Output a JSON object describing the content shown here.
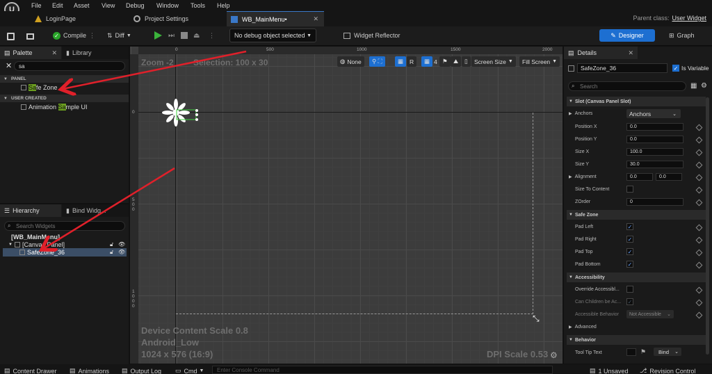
{
  "menu": [
    "File",
    "Edit",
    "Asset",
    "View",
    "Debug",
    "Window",
    "Tools",
    "Help"
  ],
  "tabs": [
    {
      "label": "LoginPage"
    },
    {
      "label": "Project Settings"
    },
    {
      "label": "WB_MainMenu•"
    }
  ],
  "parent_class": {
    "label": "Parent class:",
    "value": "User Widget"
  },
  "toolbar": {
    "compile": "Compile",
    "diff": "Diff",
    "debug_object": "No debug object selected",
    "widget_reflector": "Widget Reflector",
    "designer": "Designer",
    "graph": "Graph"
  },
  "palette": {
    "tab_palette": "Palette",
    "tab_library": "Library",
    "search_value": "sa",
    "cat_panel": "PANEL",
    "item_safezone": {
      "pre": "",
      "match": "Sa",
      "post": "fe Zone"
    },
    "cat_user": "USER CREATED",
    "item_anim": {
      "pre": "Animation ",
      "match": "Sa",
      "post": "mple UI"
    }
  },
  "hierarchy": {
    "tab_hierarchy": "Hierarchy",
    "tab_bind": "Bind Widg...",
    "search_placeholder": "Search Widgets",
    "root": "[WB_MainMenu]",
    "canvas": "[Canvas Panel]",
    "safezone": "SafeZone_36"
  },
  "canvas": {
    "zoom": "Zoom -2",
    "selection": "Selection: 100 x 30",
    "none_label": "None",
    "r_label": "R",
    "grid_value": "4",
    "screen_size": "Screen Size",
    "fill_screen": "Fill Screen",
    "ruler_top": [
      "0",
      "500",
      "1000",
      "1500",
      "2000"
    ],
    "ruler_left": [
      "0",
      "5\n0\n0",
      "1\n0\n0\n0"
    ],
    "device_scale": "Device Content Scale 0.8",
    "device": "Android_Low",
    "resolution": "1024 x 576 (16:9)",
    "dpi": "DPI Scale 0.53"
  },
  "details": {
    "tab": "Details",
    "name": "SafeZone_36",
    "is_variable": "Is Variable",
    "search_placeholder": "Search",
    "slot_section": "Slot (Canvas Panel Slot)",
    "anchors_label": "Anchors",
    "anchors_value": "Anchors",
    "position_x": "Position X",
    "position_x_val": "0.0",
    "position_y": "Position Y",
    "position_y_val": "0.0",
    "size_x": "Size X",
    "size_x_val": "100.0",
    "size_y": "Size Y",
    "size_y_val": "30.0",
    "alignment": "Alignment",
    "align_x": "0.0",
    "align_y": "0.0",
    "size_to_content": "Size To Content",
    "zorder": "ZOrder",
    "zorder_val": "0",
    "safe_zone_section": "Safe Zone",
    "pad_left": "Pad Left",
    "pad_right": "Pad Right",
    "pad_top": "Pad Top",
    "pad_bottom": "Pad Bottom",
    "accessibility_section": "Accessibility",
    "override_access": "Override Accessibl...",
    "children_access": "Can Children be Ac...",
    "access_behavior": "Accessible Behavior",
    "access_behavior_val": "Not Accessible",
    "advanced": "Advanced",
    "behavior_section": "Behavior",
    "tooltip": "Tool Tip Text",
    "bind": "Bind"
  },
  "statusbar": {
    "content_drawer": "Content Drawer",
    "animations": "Animations",
    "output_log": "Output Log",
    "cmd": "Cmd",
    "console_placeholder": "Enter Console Command",
    "unsaved": "1 Unsaved",
    "revision": "Revision Control"
  },
  "colors": {
    "accent": "#1d6fd1",
    "highlight": "#6b9e1f",
    "arrow": "#e0202a"
  }
}
